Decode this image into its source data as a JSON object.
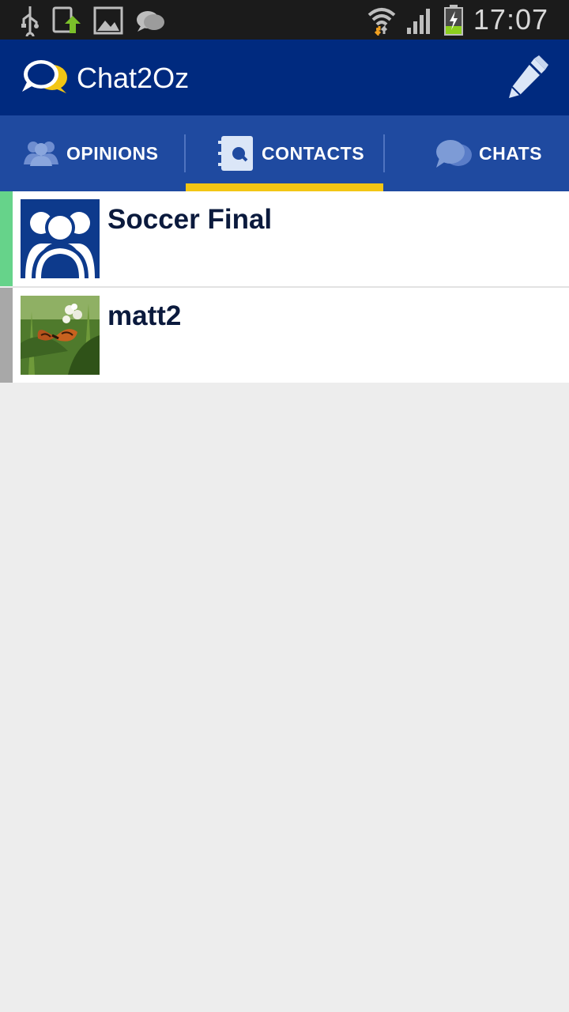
{
  "status_bar": {
    "time": "17:07",
    "left_icons": [
      "usb-icon",
      "file-upload-icon",
      "image-icon",
      "chat-notification-icon"
    ],
    "right_icons": [
      "wifi-icon",
      "signal-icon",
      "battery-charging-icon"
    ]
  },
  "app_bar": {
    "title": "Chat2Oz",
    "logo_icon": "chat-bubbles-logo-icon",
    "action_icon": "pencil-icon"
  },
  "tabs": [
    {
      "label": "OPINIONS",
      "icon": "people-icon",
      "selected": false
    },
    {
      "label": "CONTACTS",
      "icon": "contacts-book-icon",
      "selected": true
    },
    {
      "label": "CHATS",
      "icon": "chat-bubbles-icon",
      "selected": false
    }
  ],
  "contacts": [
    {
      "name": "Soccer Final",
      "avatar": "group-avatar-icon",
      "status_color": "#66d38a"
    },
    {
      "name": "matt2",
      "avatar": "butterfly-photo",
      "status_color": "#a8a8a8"
    }
  ],
  "colors": {
    "app_bar": "#002a7f",
    "tab_bar": "#1f4aa0",
    "indicator": "#f3c614",
    "background": "#ededed"
  }
}
